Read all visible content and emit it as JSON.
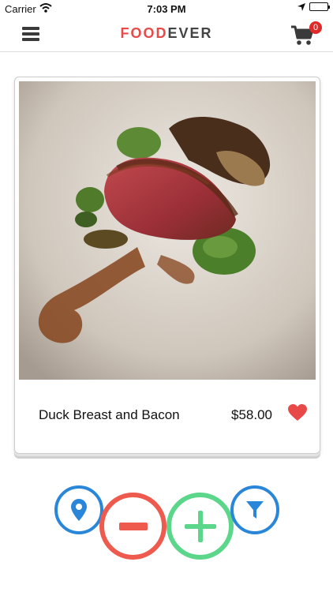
{
  "status_bar": {
    "carrier": "Carrier",
    "time": "7:03 PM"
  },
  "header": {
    "brand_part1": "FOOD",
    "brand_part2": "EVER",
    "cart_count": "0"
  },
  "card": {
    "dish_name": "Duck Breast and Bacon",
    "price": "$58.00",
    "favorited": true
  },
  "colors": {
    "brand_red": "#e84a4a",
    "brand_gray": "#444444",
    "location_filter_blue": "#2a86d8",
    "remove_red": "#ef5a4e",
    "add_green": "#5bd68a",
    "heart": "#e84a4a"
  },
  "icons": [
    "menu-icon",
    "cart-icon",
    "heart-icon",
    "location-pin-icon",
    "minus-icon",
    "plus-icon",
    "filter-icon"
  ]
}
